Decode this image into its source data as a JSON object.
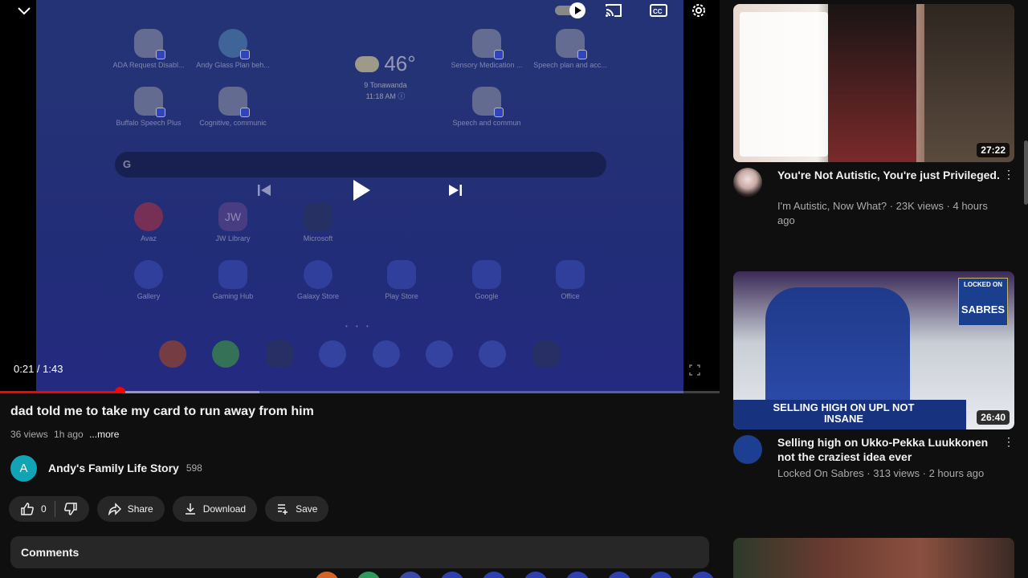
{
  "player": {
    "time": "0:21 / 1:43",
    "progress": {
      "played": 0.1667,
      "buffered": 0.361
    },
    "desktop": {
      "weather": {
        "temp": "46°",
        "location": "9 Tonawanda",
        "time": "11:18 AM ⓘ"
      },
      "apps": [
        {
          "label": "ADA Request Disabl..."
        },
        {
          "label": "Andy Glass Plan beh..."
        },
        {
          "label": "Sensory Medication ..."
        },
        {
          "label": "Speech plan and acc..."
        },
        {
          "label": "Buffalo Speech Plus"
        },
        {
          "label": "Cognitive, communic"
        },
        {
          "label": "Speech and commun"
        },
        {
          "label": "Avaz"
        },
        {
          "label": "JW Library"
        },
        {
          "label": "Microsoft"
        },
        {
          "label": "Gallery"
        },
        {
          "label": "Gaming Hub"
        },
        {
          "label": "Galaxy Store"
        },
        {
          "label": "Play Store"
        },
        {
          "label": "Google"
        },
        {
          "label": "Office"
        }
      ],
      "search_logo": "G",
      "jw_text": "JW"
    },
    "icons": [
      "chevron-down-icon",
      "autoplay-toggle",
      "cast-icon",
      "captions-icon",
      "settings-gear-icon",
      "previous-icon",
      "play-icon",
      "next-icon",
      "fullscreen-icon"
    ]
  },
  "video": {
    "title": "dad told me to take my card to run away from him",
    "views": "36 views",
    "age": "1h ago",
    "more": "...more",
    "channel": {
      "initial": "A",
      "name": "Andy's Family Life Story",
      "subs": "598"
    },
    "actions": {
      "likes": "0",
      "share": "Share",
      "download": "Download",
      "save": "Save"
    },
    "comments_label": "Comments"
  },
  "sidebar": {
    "items": [
      {
        "title": "You're Not Autistic, You're just Privileged.",
        "channel": "I'm Autistic, Now What?",
        "meta": "I'm Autistic, Now What? · 23K views · 4 hours ago",
        "duration": "27:22"
      },
      {
        "title": "Selling high on Ukko-Pekka Luukkonen not the craziest idea ever",
        "channel": "Locked On Sabres",
        "meta": "Locked On Sabres · 313 views · 2 hours ago",
        "duration": "26:40",
        "thumb_text": "SELLING HIGH ON UPL NOT INSANE",
        "badge_top": "LOCKED ON",
        "badge_main": "SABRES"
      }
    ]
  },
  "colors": {
    "accent": "#ff0000",
    "bg": "#0f0f0f",
    "pill": "#272727",
    "avatar": "#12a4b5"
  }
}
